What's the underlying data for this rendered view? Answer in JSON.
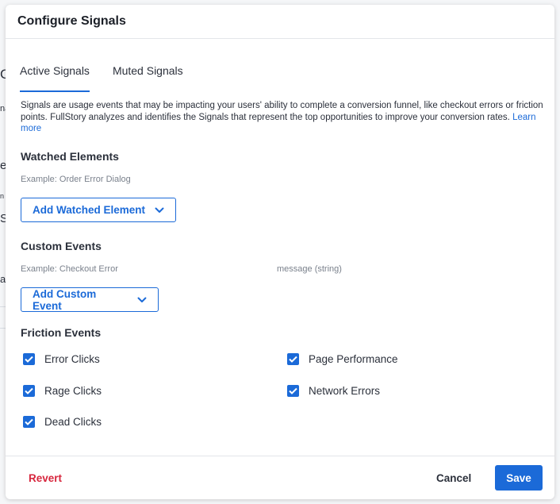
{
  "background": {
    "fragments": [
      "Co",
      "na",
      "e",
      "n",
      "S",
      "av"
    ]
  },
  "modal": {
    "title": "Configure Signals",
    "tabs": [
      {
        "label": "Active Signals",
        "active": true
      },
      {
        "label": "Muted Signals",
        "active": false
      }
    ],
    "description": "Signals are usage events that may be impacting your users' ability to complete a conversion funnel, like checkout errors or friction points. FullStory analyzes and identifies the Signals that represent the top opportunities to improve your conversion rates.",
    "learn_more": "Learn more",
    "watched_elements": {
      "title": "Watched Elements",
      "example": "Example: Order Error Dialog",
      "button": "Add Watched Element"
    },
    "custom_events": {
      "title": "Custom Events",
      "example": "Example: Checkout Error",
      "example_property": "message (string)",
      "button": "Add Custom Event"
    },
    "friction_events": {
      "title": "Friction Events",
      "items": [
        {
          "label": "Error Clicks",
          "checked": true
        },
        {
          "label": "Rage Clicks",
          "checked": true
        },
        {
          "label": "Dead Clicks",
          "checked": true
        },
        {
          "label": "Page Performance",
          "checked": true
        },
        {
          "label": "Network Errors",
          "checked": true
        }
      ]
    },
    "footer": {
      "revert": "Revert",
      "cancel": "Cancel",
      "save": "Save"
    }
  },
  "colors": {
    "accent": "#1b6ad8",
    "danger": "#d7263d"
  }
}
